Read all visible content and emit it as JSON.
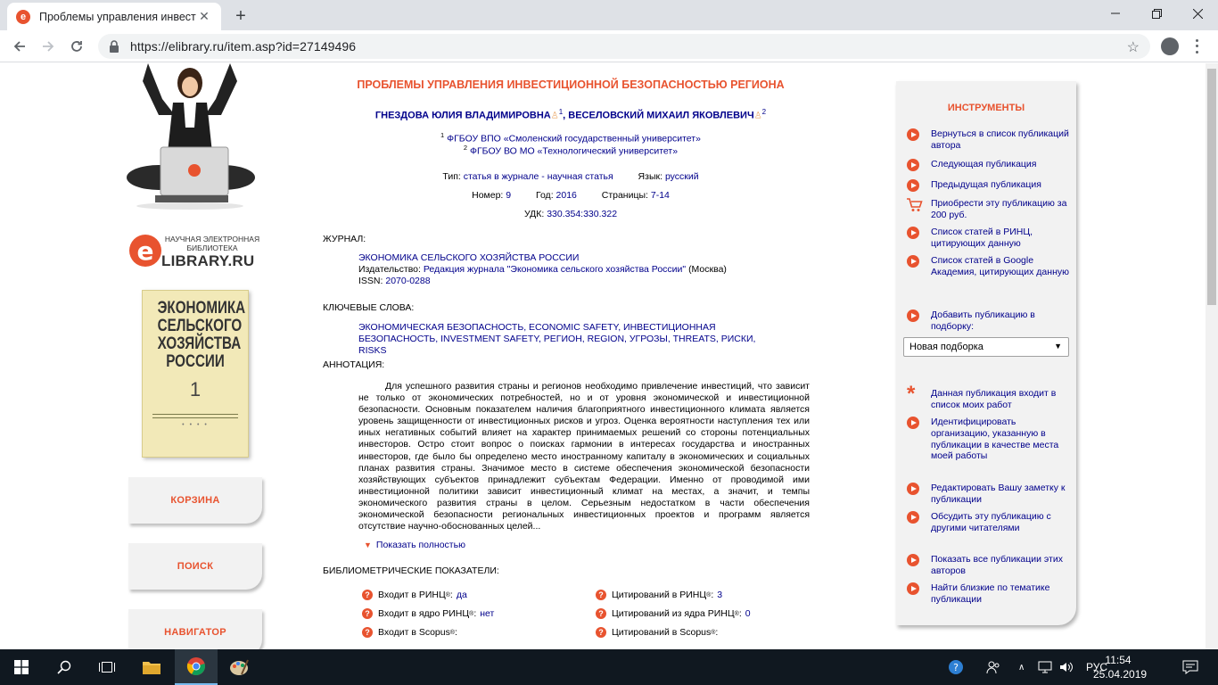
{
  "browser": {
    "tab_title": "Проблемы управления инвест",
    "url": "https://elibrary.ru/item.asp?id=27149496"
  },
  "sidebar": {
    "logo_small": "НАУЧНАЯ ЭЛЕКТРОННАЯ БИБЛИОТЕКА",
    "logo_letter": "e",
    "logo_big": "LIBRARY.RU",
    "cover_title": "ЭКОНОМИКА СЕЛЬСКОГО ХОЗЯЙСТВА РОССИИ",
    "cover_number": "1",
    "buttons": [
      "КОРЗИНА",
      "ПОИСК",
      "НАВИГАТОР"
    ]
  },
  "article": {
    "title": "ПРОБЛЕМЫ УПРАВЛЕНИЯ ИНВЕСТИЦИОННОЙ БЕЗОПАСНОСТЬЮ РЕГИОНА",
    "authors": [
      {
        "name": "ГНЕЗДОВА ЮЛИЯ ВЛАДИМИРОВНА",
        "ref": "1"
      },
      {
        "name": "ВЕСЕЛОВСКИЙ МИХАИЛ ЯКОВЛЕВИЧ",
        "ref": "2"
      }
    ],
    "affiliations": [
      {
        "ref": "1",
        "name": "ФГБОУ ВПО «Смоленский государственный университет»"
      },
      {
        "ref": "2",
        "name": "ФГБОУ ВО МО «Технологический университет»"
      }
    ],
    "type_label": "Тип:",
    "type_value": "статья в журнале - научная статья",
    "lang_label": "Язык:",
    "lang_value": "русский",
    "number_label": "Номер:",
    "number_value": "9",
    "year_label": "Год:",
    "year_value": "2016",
    "pages_label": "Страницы:",
    "pages_value": "7-14",
    "udk_label": "УДК:",
    "udk_value": "330.354:330.322",
    "journal_label": "ЖУРНАЛ:",
    "journal_name": "ЭКОНОМИКА СЕЛЬСКОГО ХОЗЯЙСТВА РОССИИ",
    "publisher_label": "Издательство:",
    "publisher_name": "Редакция журнала \"Экономика сельского хозяйства России\"",
    "publisher_city": "(Москва)",
    "issn_label": "ISSN:",
    "issn_value": "2070-0288",
    "keywords_label": "КЛЮЧЕВЫЕ СЛОВА:",
    "keywords": "ЭКОНОМИЧЕСКАЯ БЕЗОПАСНОСТЬ, ECONOMIC SAFETY, ИНВЕСТИЦИОННАЯ БЕЗОПАСНОСТЬ, INVESTMENT SAFETY, РЕГИОН, REGION, УГРОЗЫ, THREATS, РИСКИ, RISKS",
    "abstract_label": "АННОТАЦИЯ:",
    "abstract": "Для успешного развития страны и регионов необходимо привлечение инвестиций, что зависит не только от экономических потребностей, но и от уровня экономической и инвестиционной безопасности. Основным показателем наличия благоприятного инвестиционного климата является уровень защищенности от инвестиционных рисков и угроз. Оценка вероятности наступления тех или иных негативных событий влияет на характер принимаемых решений со стороны потенциальных инвесторов. Остро стоит вопрос о поисках гармонии в интересах государства и иностранных инвесторов, где было бы определено место иностранному капиталу в экономических и социальных планах развития страны. Значимое место в системе обеспечения экономической безопасности хозяйствующих субъектов принадлежит субъектам Федерации. Именно от проводимой ими инвестиционной политики зависит инвестиционный климат на местах, а значит, и темпы экономического развития страны в целом. Серьезным недостатком в части обеспечения экономической безопасности региональных инвестиционных проектов и программ является отсутствие научно-обоснованных целей...",
    "show_more": "Показать полностью",
    "bib_label": "БИБЛИОМЕТРИЧЕСКИЕ ПОКАЗАТЕЛИ:",
    "bib_left": [
      {
        "label": "Входит в РИНЦ",
        "value": "да"
      },
      {
        "label": "Входит в ядро РИНЦ",
        "value": "нет"
      },
      {
        "label": "Входит в Scopus",
        "value": ""
      }
    ],
    "bib_right": [
      {
        "label": "Цитирований в РИНЦ",
        "value": "3"
      },
      {
        "label": "Цитирований из ядра РИНЦ",
        "value": "0"
      },
      {
        "label": "Цитирований в Scopus",
        "value": ""
      }
    ],
    "reg_mark": "®"
  },
  "tools": {
    "title": "ИНСТРУМЕНТЫ",
    "items": [
      "Вернуться в список публикаций автора",
      "Следующая публикация",
      "Предыдущая публикация",
      "Приобрести эту публикацию за 200 руб.",
      "Список статей в РИНЦ, цитирующих данную",
      "Список статей в Google Академия, цитирующих данную",
      "Добавить публикацию в подборку:",
      "Данная публикация входит в список моих работ",
      "Идентифицировать организацию, указанную в публикации в качестве места моей работы",
      "Редактировать Вашу заметку к публикации",
      "Обсудить эту публикацию с другими читателями",
      "Показать все публикации этих авторов",
      "Найти близкие по тематике публикации"
    ],
    "select_value": "Новая подборка"
  },
  "taskbar": {
    "lang": "РУС",
    "time": "11:54",
    "date": "25.04.2019"
  },
  "colors": {
    "accent": "#e8532f",
    "link": "#00008b",
    "panel": "#f2f2f2"
  }
}
